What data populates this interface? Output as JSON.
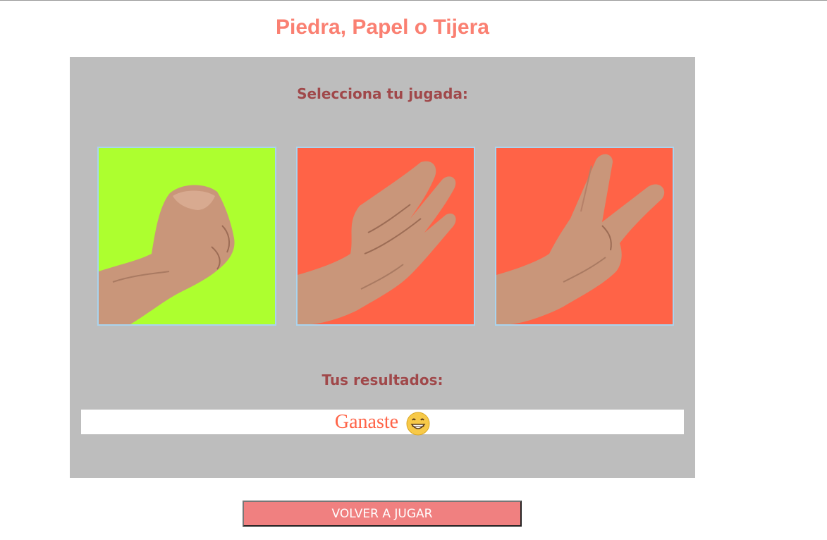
{
  "page": {
    "title": "Piedra, Papel o Tijera"
  },
  "selection": {
    "heading": "Selecciona tu jugada:",
    "options": [
      {
        "name": "piedra",
        "icon": "fist-hand-icon",
        "background": "#adff2f"
      },
      {
        "name": "papel",
        "icon": "open-hand-icon",
        "background": "#ff6347"
      },
      {
        "name": "tijera",
        "icon": "peace-sign-hand-icon",
        "background": "#ff6347"
      }
    ]
  },
  "results": {
    "heading": "Tus resultados:",
    "message": "Ganaste",
    "emoji_icon": "grinning-face-icon"
  },
  "actions": {
    "replay_label": "VOLVER A JUGAR"
  },
  "colors": {
    "title": "#fa8072",
    "panel": "#bdbdbd",
    "heading": "#a0484a",
    "result_text": "#ff6347",
    "button": "#f08080"
  }
}
